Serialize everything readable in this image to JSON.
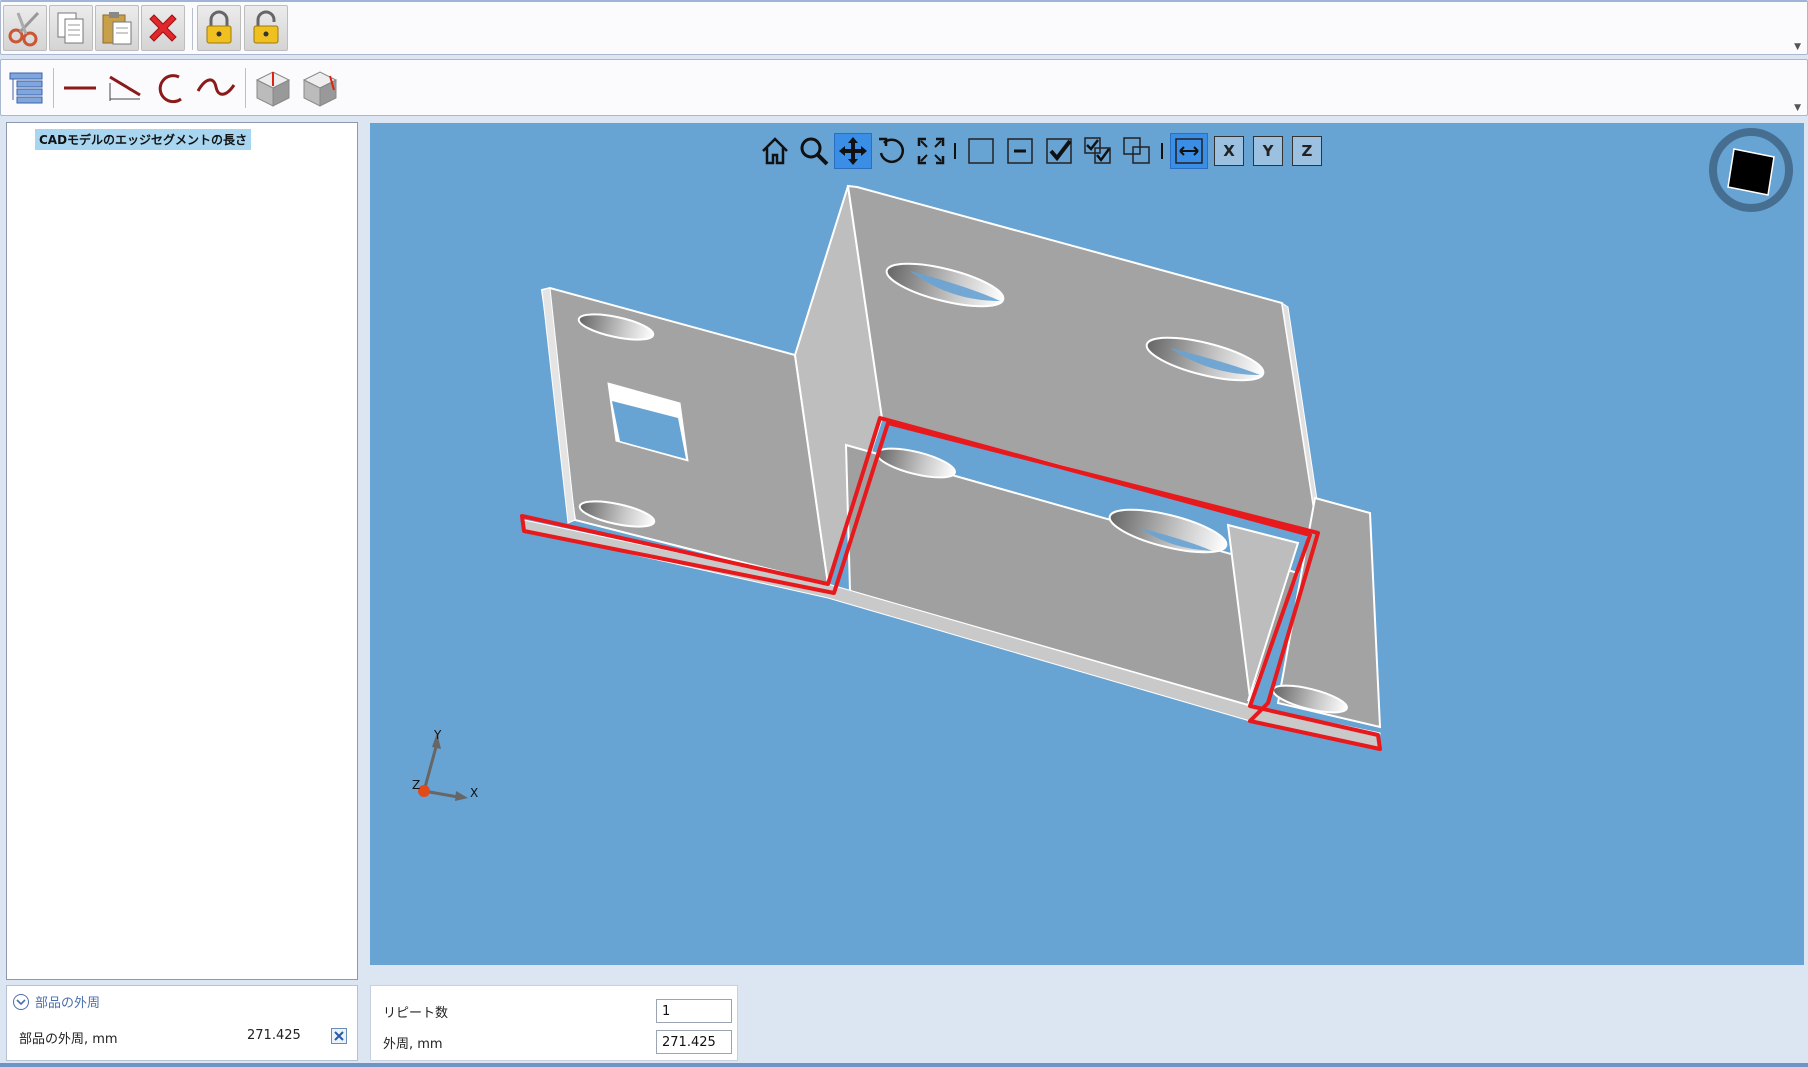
{
  "colors": {
    "viewport_bg": "#67a3d3",
    "highlight": "#e8191d",
    "part_face": "#a3a3a3",
    "active_button": "#3a8ee6",
    "tree_selection": "#a8d6f0",
    "section_header": "#4a6fae"
  },
  "toolbar_main": {
    "icons": [
      "scissors-icon",
      "copy-icon",
      "paste-icon",
      "delete-icon",
      "lock-icon",
      "unlock-icon"
    ]
  },
  "toolbar_edges": {
    "icons": [
      "tree-view-icon",
      "line-segment-icon",
      "dimension-line-icon",
      "arc-icon",
      "curve-icon",
      "solid-box-icon",
      "solid-box-edge-icon"
    ]
  },
  "tree": {
    "root_label": "CADモデルのエッジセグメントの長さ"
  },
  "viewport": {
    "toolbar_icons": [
      "home-icon",
      "zoom-icon",
      "pan-icon",
      "rotate-icon",
      "fit-view-icon",
      "select-none-icon",
      "deselect-icon",
      "select-icon",
      "select-multiple-icon",
      "select-overlap-icon",
      "measure-edge-icon"
    ],
    "active_tool": "pan-icon",
    "axis_buttons": [
      "X",
      "Y",
      "Z"
    ],
    "triad_labels": {
      "x": "X",
      "y": "Y",
      "z": "Z"
    }
  },
  "props_left": {
    "section_title": "部品の外周",
    "row_label": "部品の外周, mm",
    "row_value": "271.425"
  },
  "props_right": {
    "repeat_label": "リピート数",
    "repeat_value": "1",
    "perimeter_label": "外周, mm",
    "perimeter_value": "271.425"
  }
}
